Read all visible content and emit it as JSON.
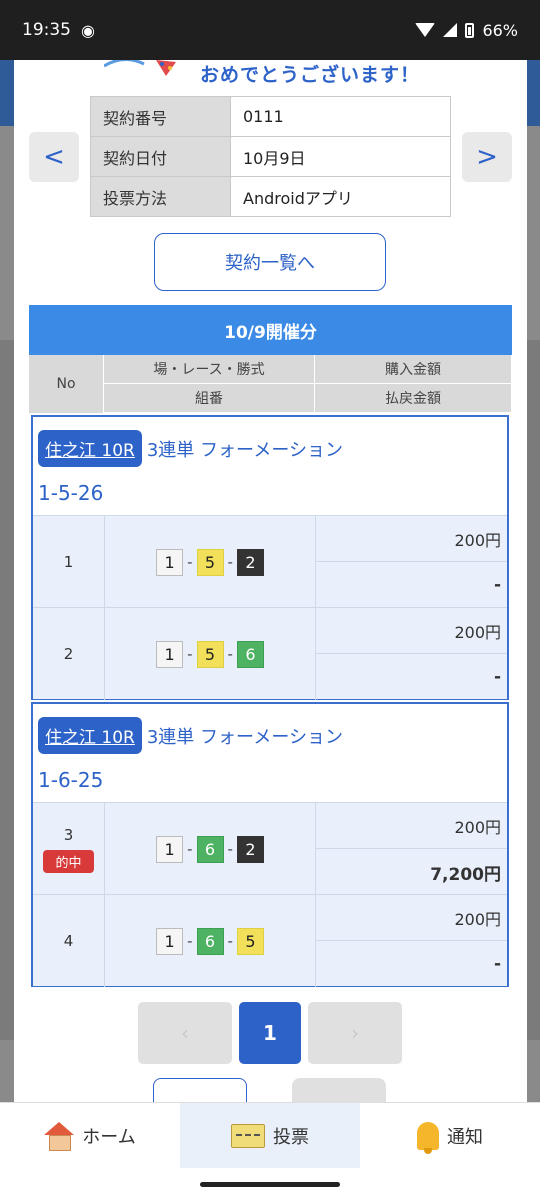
{
  "status_bar": {
    "time": "19:35",
    "battery": "66%"
  },
  "banner": {
    "text": "おめでとうございます！"
  },
  "contract": {
    "rows": [
      {
        "label": "契約番号",
        "value": "0111"
      },
      {
        "label": "契約日付",
        "value": "10月9日"
      },
      {
        "label": "投票方法",
        "value": "Androidアプリ"
      }
    ]
  },
  "nav_arrows": {
    "prev": "<",
    "next": ">"
  },
  "list_button": "契約一覧へ",
  "date_header": "10/9開催分",
  "columns": {
    "no": "No",
    "place_race_type": "場・レース・勝式",
    "combination": "組番",
    "purchase_amount": "購入金額",
    "payout_amount": "払戻金額"
  },
  "bets": [
    {
      "race": "住之江 10R",
      "type": "3連単 フォーメーション",
      "code": "1-5-26",
      "rows": [
        {
          "no": "1",
          "nums": [
            "1",
            "5",
            "2"
          ],
          "purchase": "200円",
          "payout": "-"
        },
        {
          "no": "2",
          "nums": [
            "1",
            "5",
            "6"
          ],
          "purchase": "200円",
          "payout": "-"
        }
      ]
    },
    {
      "race": "住之江 10R",
      "type": "3連単 フォーメーション",
      "code": "1-6-25",
      "rows": [
        {
          "no": "3",
          "hit": "的中",
          "nums": [
            "1",
            "6",
            "2"
          ],
          "purchase": "200円",
          "payout": "7,200円"
        },
        {
          "no": "4",
          "nums": [
            "1",
            "6",
            "5"
          ],
          "purchase": "200円",
          "payout": "-"
        }
      ]
    }
  ],
  "pager": {
    "prev": "‹",
    "current": "1",
    "next": "›"
  },
  "bottom_nav": [
    {
      "label": "ホーム",
      "icon": "home-icon"
    },
    {
      "label": "投票",
      "icon": "ticket-icon"
    },
    {
      "label": "通知",
      "icon": "bell-icon"
    }
  ]
}
